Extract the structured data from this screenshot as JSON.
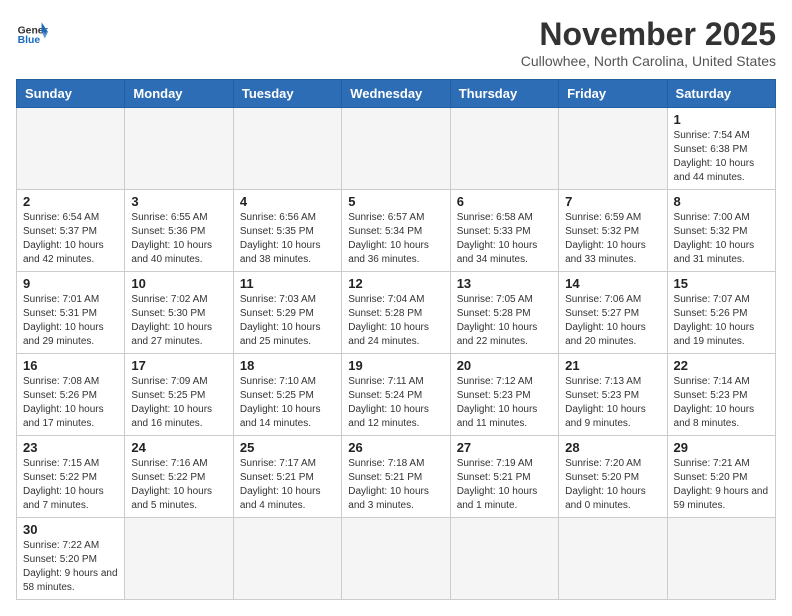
{
  "header": {
    "logo_general": "General",
    "logo_blue": "Blue",
    "month_year": "November 2025",
    "location": "Cullowhee, North Carolina, United States"
  },
  "days_of_week": [
    "Sunday",
    "Monday",
    "Tuesday",
    "Wednesday",
    "Thursday",
    "Friday",
    "Saturday"
  ],
  "weeks": [
    [
      {
        "day": "",
        "info": ""
      },
      {
        "day": "",
        "info": ""
      },
      {
        "day": "",
        "info": ""
      },
      {
        "day": "",
        "info": ""
      },
      {
        "day": "",
        "info": ""
      },
      {
        "day": "",
        "info": ""
      },
      {
        "day": "1",
        "info": "Sunrise: 7:54 AM\nSunset: 6:38 PM\nDaylight: 10 hours and 44 minutes."
      }
    ],
    [
      {
        "day": "2",
        "info": "Sunrise: 6:54 AM\nSunset: 5:37 PM\nDaylight: 10 hours and 42 minutes."
      },
      {
        "day": "3",
        "info": "Sunrise: 6:55 AM\nSunset: 5:36 PM\nDaylight: 10 hours and 40 minutes."
      },
      {
        "day": "4",
        "info": "Sunrise: 6:56 AM\nSunset: 5:35 PM\nDaylight: 10 hours and 38 minutes."
      },
      {
        "day": "5",
        "info": "Sunrise: 6:57 AM\nSunset: 5:34 PM\nDaylight: 10 hours and 36 minutes."
      },
      {
        "day": "6",
        "info": "Sunrise: 6:58 AM\nSunset: 5:33 PM\nDaylight: 10 hours and 34 minutes."
      },
      {
        "day": "7",
        "info": "Sunrise: 6:59 AM\nSunset: 5:32 PM\nDaylight: 10 hours and 33 minutes."
      },
      {
        "day": "8",
        "info": "Sunrise: 7:00 AM\nSunset: 5:32 PM\nDaylight: 10 hours and 31 minutes."
      }
    ],
    [
      {
        "day": "9",
        "info": "Sunrise: 7:01 AM\nSunset: 5:31 PM\nDaylight: 10 hours and 29 minutes."
      },
      {
        "day": "10",
        "info": "Sunrise: 7:02 AM\nSunset: 5:30 PM\nDaylight: 10 hours and 27 minutes."
      },
      {
        "day": "11",
        "info": "Sunrise: 7:03 AM\nSunset: 5:29 PM\nDaylight: 10 hours and 25 minutes."
      },
      {
        "day": "12",
        "info": "Sunrise: 7:04 AM\nSunset: 5:28 PM\nDaylight: 10 hours and 24 minutes."
      },
      {
        "day": "13",
        "info": "Sunrise: 7:05 AM\nSunset: 5:28 PM\nDaylight: 10 hours and 22 minutes."
      },
      {
        "day": "14",
        "info": "Sunrise: 7:06 AM\nSunset: 5:27 PM\nDaylight: 10 hours and 20 minutes."
      },
      {
        "day": "15",
        "info": "Sunrise: 7:07 AM\nSunset: 5:26 PM\nDaylight: 10 hours and 19 minutes."
      }
    ],
    [
      {
        "day": "16",
        "info": "Sunrise: 7:08 AM\nSunset: 5:26 PM\nDaylight: 10 hours and 17 minutes."
      },
      {
        "day": "17",
        "info": "Sunrise: 7:09 AM\nSunset: 5:25 PM\nDaylight: 10 hours and 16 minutes."
      },
      {
        "day": "18",
        "info": "Sunrise: 7:10 AM\nSunset: 5:25 PM\nDaylight: 10 hours and 14 minutes."
      },
      {
        "day": "19",
        "info": "Sunrise: 7:11 AM\nSunset: 5:24 PM\nDaylight: 10 hours and 12 minutes."
      },
      {
        "day": "20",
        "info": "Sunrise: 7:12 AM\nSunset: 5:23 PM\nDaylight: 10 hours and 11 minutes."
      },
      {
        "day": "21",
        "info": "Sunrise: 7:13 AM\nSunset: 5:23 PM\nDaylight: 10 hours and 9 minutes."
      },
      {
        "day": "22",
        "info": "Sunrise: 7:14 AM\nSunset: 5:23 PM\nDaylight: 10 hours and 8 minutes."
      }
    ],
    [
      {
        "day": "23",
        "info": "Sunrise: 7:15 AM\nSunset: 5:22 PM\nDaylight: 10 hours and 7 minutes."
      },
      {
        "day": "24",
        "info": "Sunrise: 7:16 AM\nSunset: 5:22 PM\nDaylight: 10 hours and 5 minutes."
      },
      {
        "day": "25",
        "info": "Sunrise: 7:17 AM\nSunset: 5:21 PM\nDaylight: 10 hours and 4 minutes."
      },
      {
        "day": "26",
        "info": "Sunrise: 7:18 AM\nSunset: 5:21 PM\nDaylight: 10 hours and 3 minutes."
      },
      {
        "day": "27",
        "info": "Sunrise: 7:19 AM\nSunset: 5:21 PM\nDaylight: 10 hours and 1 minute."
      },
      {
        "day": "28",
        "info": "Sunrise: 7:20 AM\nSunset: 5:20 PM\nDaylight: 10 hours and 0 minutes."
      },
      {
        "day": "29",
        "info": "Sunrise: 7:21 AM\nSunset: 5:20 PM\nDaylight: 9 hours and 59 minutes."
      }
    ],
    [
      {
        "day": "30",
        "info": "Sunrise: 7:22 AM\nSunset: 5:20 PM\nDaylight: 9 hours and 58 minutes."
      },
      {
        "day": "",
        "info": ""
      },
      {
        "day": "",
        "info": ""
      },
      {
        "day": "",
        "info": ""
      },
      {
        "day": "",
        "info": ""
      },
      {
        "day": "",
        "info": ""
      },
      {
        "day": "",
        "info": ""
      }
    ]
  ]
}
